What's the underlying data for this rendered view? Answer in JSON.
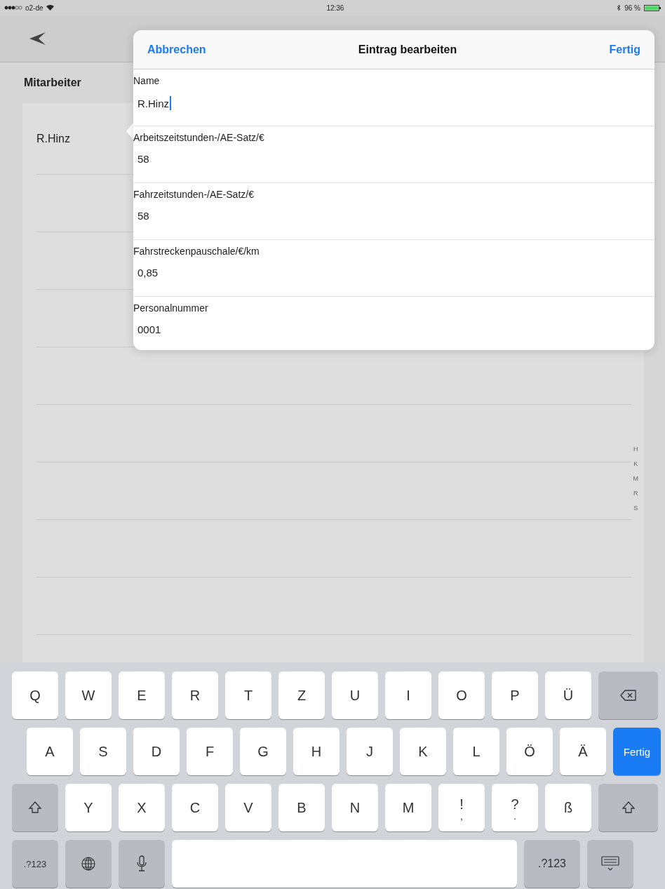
{
  "status_bar": {
    "carrier": "o2-de",
    "time": "12:36",
    "battery": "96 %"
  },
  "sidebar": {
    "title": "Mitarbeiter",
    "items": [
      {
        "name": "R.Hinz"
      }
    ],
    "index": [
      "H",
      "K",
      "M",
      "R",
      "S"
    ]
  },
  "popover": {
    "cancel": "Abbrechen",
    "title": "Eintrag bearbeiten",
    "done": "Fertig",
    "fields": [
      {
        "label": "Name",
        "value": "R.Hinz",
        "focused": true
      },
      {
        "label": "Arbeitszeitstunden-/AE-Satz/€",
        "value": "58",
        "focused": false
      },
      {
        "label": "Fahrzeitstunden-/AE-Satz/€",
        "value": "58",
        "focused": false
      },
      {
        "label": "Fahrstreckenpauschale/€/km",
        "value": "0,85",
        "focused": false
      },
      {
        "label": "Personalnummer",
        "value": "0001",
        "focused": false
      }
    ]
  },
  "keyboard": {
    "rows": [
      [
        {
          "kind": "letter",
          "label": "Q"
        },
        {
          "kind": "letter",
          "label": "W"
        },
        {
          "kind": "letter",
          "label": "E"
        },
        {
          "kind": "letter",
          "label": "R"
        },
        {
          "kind": "letter",
          "label": "T"
        },
        {
          "kind": "letter",
          "label": "Z"
        },
        {
          "kind": "letter",
          "label": "U"
        },
        {
          "kind": "letter",
          "label": "I"
        },
        {
          "kind": "letter",
          "label": "O"
        },
        {
          "kind": "letter",
          "label": "P"
        },
        {
          "kind": "letter",
          "label": "Ü"
        },
        {
          "kind": "backspace"
        }
      ],
      [
        {
          "kind": "letter",
          "label": "A"
        },
        {
          "kind": "letter",
          "label": "S"
        },
        {
          "kind": "letter",
          "label": "D"
        },
        {
          "kind": "letter",
          "label": "F"
        },
        {
          "kind": "letter",
          "label": "G"
        },
        {
          "kind": "letter",
          "label": "H"
        },
        {
          "kind": "letter",
          "label": "J"
        },
        {
          "kind": "letter",
          "label": "K"
        },
        {
          "kind": "letter",
          "label": "L"
        },
        {
          "kind": "letter",
          "label": "Ö"
        },
        {
          "kind": "letter",
          "label": "Ä"
        },
        {
          "kind": "return",
          "label": "Fertig"
        }
      ],
      [
        {
          "kind": "shift"
        },
        {
          "kind": "letter",
          "label": "Y"
        },
        {
          "kind": "letter",
          "label": "X"
        },
        {
          "kind": "letter",
          "label": "C"
        },
        {
          "kind": "letter",
          "label": "V"
        },
        {
          "kind": "letter",
          "label": "B"
        },
        {
          "kind": "letter",
          "label": "N"
        },
        {
          "kind": "letter",
          "label": "M"
        },
        {
          "kind": "dual",
          "label": "!",
          "sub": ","
        },
        {
          "kind": "dual",
          "label": "?",
          "sub": "."
        },
        {
          "kind": "letter",
          "label": "ß"
        },
        {
          "kind": "shift"
        }
      ],
      [
        {
          "kind": "numbers",
          "label": ".?123"
        },
        {
          "kind": "globe"
        },
        {
          "kind": "mic"
        },
        {
          "kind": "space"
        },
        {
          "kind": "numbers",
          "label": ".?123"
        },
        {
          "kind": "hide"
        }
      ]
    ]
  }
}
